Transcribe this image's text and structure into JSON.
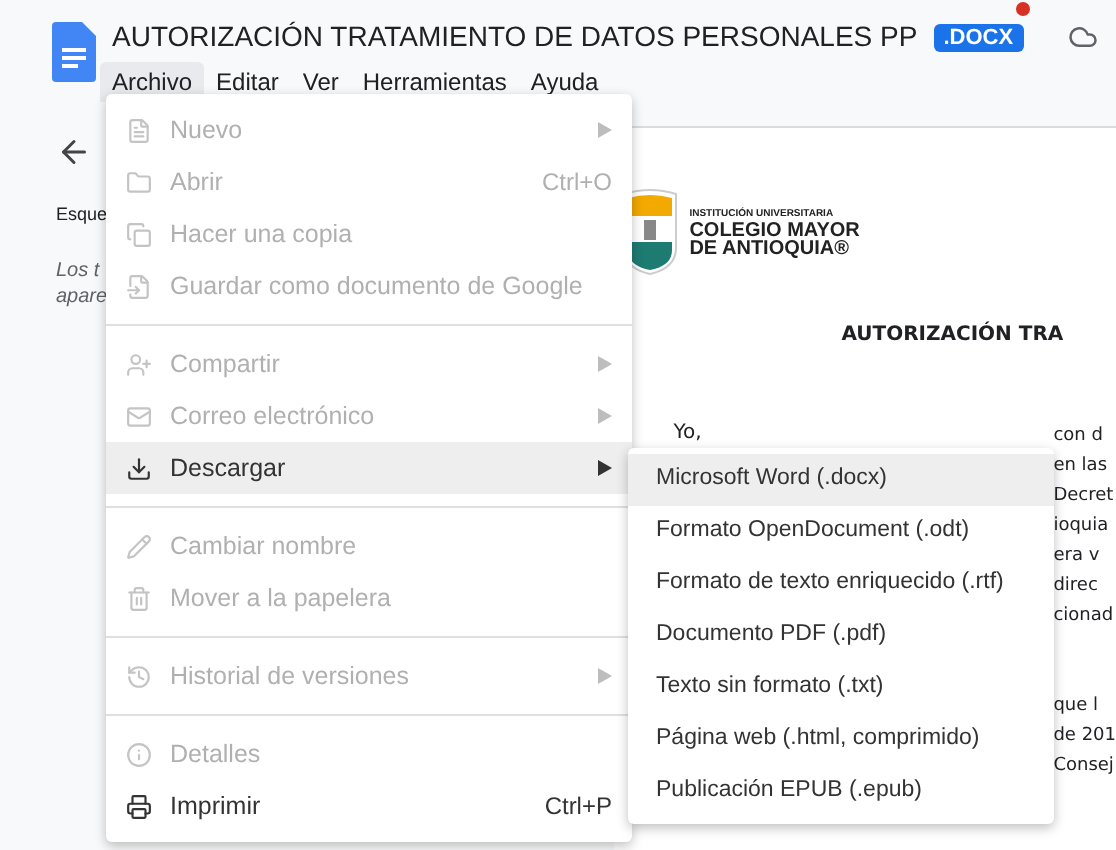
{
  "header": {
    "title": "AUTORIZACIÓN TRATAMIENTO DE DATOS PERSONALES PP",
    "badge": ".DOCX",
    "badge_dot": true,
    "menu": [
      {
        "label": "Archivo",
        "selected": true
      },
      {
        "label": "Editar",
        "selected": false
      },
      {
        "label": "Ver",
        "selected": false
      },
      {
        "label": "Herramientas",
        "selected": false
      },
      {
        "label": "Ayuda",
        "selected": false
      }
    ]
  },
  "sidebar": {
    "heading": "Esque",
    "note_lines": [
      "Los t",
      "apare"
    ]
  },
  "document": {
    "logo_lines": [
      "INSTITUCIÓN UNIVERSITARIA",
      "COLEGIO MAYOR",
      "DE ANTIOQUIA®"
    ],
    "title": "AUTORIZACIÓN TRA",
    "opening": "Yo,",
    "fragments": [
      "con d",
      "en las",
      "Decret",
      "ioquia",
      "era v",
      "direc",
      "cionad"
    ],
    "fragments_2": [
      "que l",
      "de 201",
      "Consej"
    ]
  },
  "file_menu": {
    "groups": [
      [
        {
          "kind": "new",
          "label": "Nuevo",
          "disabled": true,
          "submenu": true,
          "selected": false
        },
        {
          "kind": "open",
          "label": "Abrir",
          "shortcut": "Ctrl+O",
          "disabled": true,
          "submenu": false,
          "selected": false
        },
        {
          "kind": "copy",
          "label": "Hacer una copia",
          "disabled": true,
          "submenu": false,
          "selected": false
        },
        {
          "kind": "save",
          "label": "Guardar como documento de Google",
          "disabled": true,
          "submenu": false,
          "selected": false
        }
      ],
      [
        {
          "kind": "share",
          "label": "Compartir",
          "disabled": true,
          "submenu": true,
          "selected": false
        },
        {
          "kind": "email",
          "label": "Correo electrónico",
          "disabled": true,
          "submenu": true,
          "selected": false
        },
        {
          "kind": "download",
          "label": "Descargar",
          "disabled": false,
          "submenu": true,
          "selected": true
        }
      ],
      [
        {
          "kind": "rename",
          "label": "Cambiar nombre",
          "disabled": true,
          "submenu": false,
          "selected": false
        },
        {
          "kind": "trash",
          "label": "Mover a la papelera",
          "disabled": true,
          "submenu": false,
          "selected": false
        }
      ],
      [
        {
          "kind": "history",
          "label": "Historial de versiones",
          "disabled": true,
          "submenu": true,
          "selected": false
        }
      ],
      [
        {
          "kind": "details",
          "label": "Detalles",
          "disabled": true,
          "submenu": false,
          "selected": false
        },
        {
          "kind": "print",
          "label": "Imprimir",
          "shortcut": "Ctrl+P",
          "disabled": false,
          "submenu": false,
          "selected": false
        }
      ]
    ]
  },
  "download_menu": [
    {
      "label": "Microsoft Word (.docx)",
      "selected": true
    },
    {
      "label": "Formato OpenDocument (.odt)",
      "selected": false
    },
    {
      "label": "Formato de texto enriquecido (.rtf)",
      "selected": false
    },
    {
      "label": "Documento PDF (.pdf)",
      "selected": false
    },
    {
      "label": "Texto sin formato (.txt)",
      "selected": false
    },
    {
      "label": "Página web (.html, comprimido)",
      "selected": false
    },
    {
      "label": "Publicación EPUB (.epub)",
      "selected": false
    }
  ]
}
